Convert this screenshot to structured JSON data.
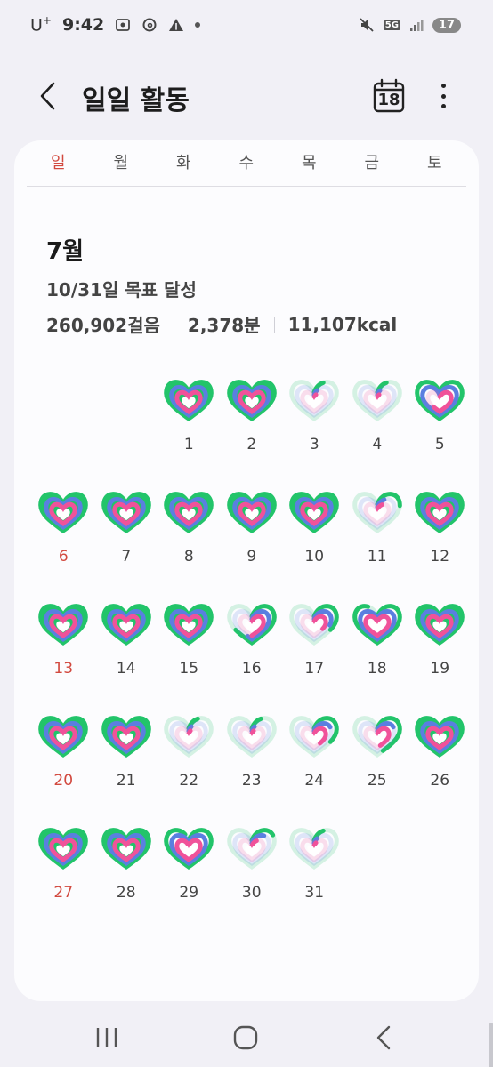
{
  "status_bar": {
    "carrier": "U",
    "carrier_sup": "+",
    "time": "9:42",
    "network": "5G",
    "battery": "17",
    "icons": [
      "gallery-icon",
      "threads-icon",
      "warning-icon",
      "dot-icon",
      "mute-icon",
      "network-5g-icon",
      "signal-icon",
      "battery-icon"
    ]
  },
  "header": {
    "title": "일일 활동",
    "calendar_day": "18",
    "back_icon": "back-arrow-icon",
    "calendar_icon": "calendar-icon",
    "more_icon": "more-options-icon"
  },
  "weekdays": [
    "일",
    "월",
    "화",
    "수",
    "목",
    "금",
    "토"
  ],
  "summary": {
    "month": "7월",
    "goal": "10/31일 목표 달성",
    "steps": "260,902걸음",
    "minutes": "2,378분",
    "calories": "11,107kcal"
  },
  "calendar": {
    "first_weekday_index": 2,
    "days": [
      {
        "day": "1",
        "steps": 1.0,
        "active": 1.0,
        "cal": 1.0
      },
      {
        "day": "2",
        "steps": 1.0,
        "active": 1.0,
        "cal": 1.0
      },
      {
        "day": "3",
        "steps": 0.1,
        "active": 0.05,
        "cal": 0.05
      },
      {
        "day": "4",
        "steps": 0.1,
        "active": 0.05,
        "cal": 0.05
      },
      {
        "day": "5",
        "steps": 1.0,
        "active": 1.0,
        "cal": 0.6
      },
      {
        "day": "6",
        "steps": 1.0,
        "active": 1.0,
        "cal": 1.0
      },
      {
        "day": "7",
        "steps": 1.0,
        "active": 1.0,
        "cal": 1.0
      },
      {
        "day": "8",
        "steps": 1.0,
        "active": 1.0,
        "cal": 1.0
      },
      {
        "day": "9",
        "steps": 1.0,
        "active": 1.0,
        "cal": 1.0
      },
      {
        "day": "10",
        "steps": 1.0,
        "active": 1.0,
        "cal": 1.0
      },
      {
        "day": "11",
        "steps": 0.25,
        "active": 0.1,
        "cal": 0.1
      },
      {
        "day": "12",
        "steps": 1.0,
        "active": 1.0,
        "cal": 1.0
      },
      {
        "day": "13",
        "steps": 1.0,
        "active": 1.0,
        "cal": 1.0
      },
      {
        "day": "14",
        "steps": 1.0,
        "active": 1.0,
        "cal": 1.0
      },
      {
        "day": "15",
        "steps": 1.0,
        "active": 1.0,
        "cal": 1.0
      },
      {
        "day": "16",
        "steps": 0.65,
        "active": 0.55,
        "cal": 0.5
      },
      {
        "day": "17",
        "steps": 0.35,
        "active": 0.3,
        "cal": 0.35
      },
      {
        "day": "18",
        "steps": 0.9,
        "active": 1.0,
        "cal": 1.0
      },
      {
        "day": "19",
        "steps": 1.0,
        "active": 1.0,
        "cal": 1.0
      },
      {
        "day": "20",
        "steps": 1.0,
        "active": 1.0,
        "cal": 1.0
      },
      {
        "day": "21",
        "steps": 1.0,
        "active": 1.0,
        "cal": 1.0
      },
      {
        "day": "22",
        "steps": 0.1,
        "active": 0.05,
        "cal": 0.05
      },
      {
        "day": "23",
        "steps": 0.1,
        "active": 0.05,
        "cal": 0.05
      },
      {
        "day": "24",
        "steps": 0.35,
        "active": 0.2,
        "cal": 0.4
      },
      {
        "day": "25",
        "steps": 0.45,
        "active": 0.2,
        "cal": 0.45
      },
      {
        "day": "26",
        "steps": 1.0,
        "active": 1.0,
        "cal": 1.0
      },
      {
        "day": "27",
        "steps": 1.0,
        "active": 1.0,
        "cal": 1.0
      },
      {
        "day": "28",
        "steps": 1.0,
        "active": 1.0,
        "cal": 1.0
      },
      {
        "day": "29",
        "steps": 0.95,
        "active": 1.0,
        "cal": 1.0
      },
      {
        "day": "30",
        "steps": 0.2,
        "active": 0.15,
        "cal": 0.1
      },
      {
        "day": "31",
        "steps": 0.1,
        "active": 0.05,
        "cal": 0.05
      }
    ]
  },
  "colors": {
    "steps_ring": "#22c46a",
    "active_ring": "#5a7fe0",
    "calorie_ring": "#f0529a",
    "sunday": "#d2493f"
  },
  "navbar": {
    "icons": [
      "recent-apps-icon",
      "home-icon",
      "nav-back-icon"
    ]
  }
}
